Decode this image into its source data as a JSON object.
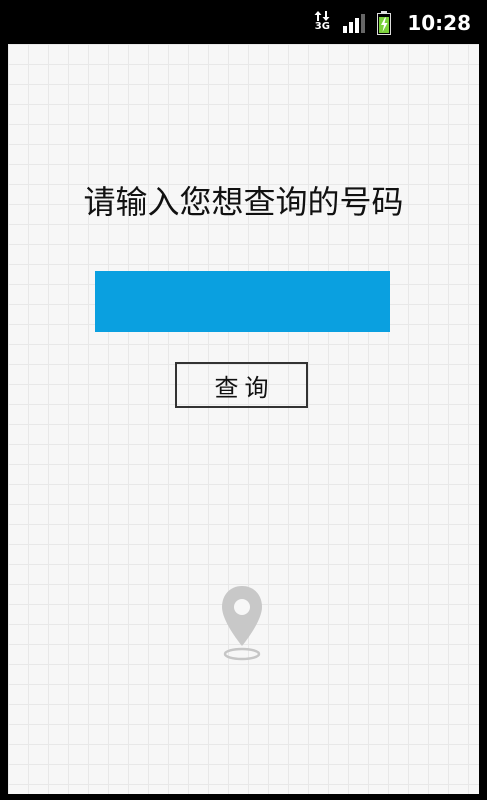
{
  "status_bar": {
    "network_label": "3G",
    "network_icon": "3g-data-icon",
    "signal_icon": "signal-strength-icon",
    "battery_icon": "battery-charging-icon",
    "time": "10:28"
  },
  "main": {
    "prompt": "请输入您想查询的号码",
    "input": {
      "value": "",
      "placeholder": ""
    },
    "query_button_label": "查询",
    "location_icon": "location-pin-icon"
  },
  "colors": {
    "input_background": "#0aa0e0",
    "background": "#f7f7f7",
    "battery_fill": "#7bd13a"
  }
}
